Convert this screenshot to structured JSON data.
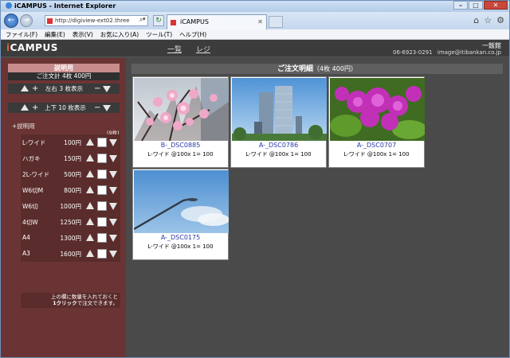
{
  "browser": {
    "title": "iCAMPUS - Internet Explorer",
    "address": "http://digiview-ext02.three",
    "tab_title": "iCAMPUS",
    "menu": [
      "ファイル(F)",
      "編集(E)",
      "表示(V)",
      "お気に入り(A)",
      "ツール(T)",
      "ヘルプ(H)"
    ]
  },
  "site": {
    "logo_i": "i",
    "logo_rest": "CAMPUS",
    "nav_list": "一覧",
    "nav_register": "レジ",
    "shop_name": "一飯館",
    "shop_tel": "06-6923-0291",
    "shop_mail": "image@itibankan.co.jp"
  },
  "sidebar": {
    "title": "説明用",
    "total": "ご注文計  4枚  400円",
    "lr_label": "左右 3 枚表示",
    "ud_label": "上下 10 枚表示",
    "help_link": "+説明用",
    "unit": "(9枚)",
    "sizes": [
      {
        "name": "L-ワイド",
        "price": "100円"
      },
      {
        "name": "ハガキ",
        "price": "150円"
      },
      {
        "name": "2L-ワイド",
        "price": "500円"
      },
      {
        "name": "W6切M",
        "price": "800円"
      },
      {
        "name": "W6切",
        "price": "1000円"
      },
      {
        "name": "4切W",
        "price": "1250円"
      },
      {
        "name": "A4",
        "price": "1300円"
      },
      {
        "name": "A3",
        "price": "1600円"
      }
    ],
    "note_line1": "上の欄に数量を入れておくと",
    "note_bold": "1クリック",
    "note_line2": "で注文できます。"
  },
  "main": {
    "title": "ご注文明細",
    "summary": "（4枚 400円）",
    "photos": [
      {
        "file": "B-_DSC0885",
        "info": "L-ワイド @100x 1= 100"
      },
      {
        "file": "A-_DSC0786",
        "info": "L-ワイド @100x 1= 100"
      },
      {
        "file": "A-_DSC0707",
        "info": "L-ワイド @100x 1= 100"
      },
      {
        "file": "A-_DSC0175",
        "info": "L-ワイド @100x 1= 100"
      }
    ]
  },
  "colors": {
    "sidebar_bg": "#6b3434",
    "main_bg": "#4a4a4a",
    "link_blue": "#2a3aa8",
    "logo_accent": "#e0602e"
  }
}
